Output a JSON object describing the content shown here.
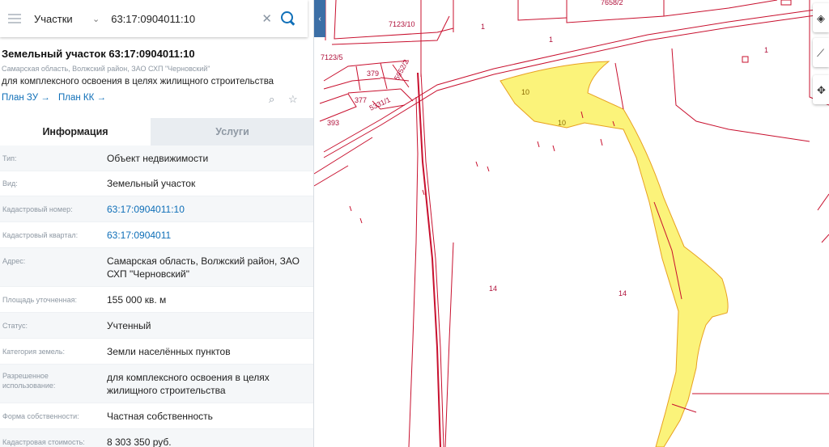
{
  "search": {
    "type_label": "Участки",
    "query": "63:17:0904011:10"
  },
  "parcel": {
    "title": "Земельный участок 63:17:0904011:10",
    "address": "Самарская область, Волжский район, ЗАО СХП \"Черновский\"",
    "purpose": "для комплексного освоения в целях жилищного строительства",
    "links": {
      "plan_zu": "План ЗУ →",
      "plan_kk": "План КК →"
    }
  },
  "tabs": [
    {
      "label": "Информация",
      "active": true
    },
    {
      "label": "Услуги",
      "active": false
    }
  ],
  "rows": [
    {
      "label": "Тип:",
      "value": "Объект недвижимости"
    },
    {
      "label": "Вид:",
      "value": "Земельный участок"
    },
    {
      "label": "Кадастровый номер:",
      "value": "63:17:0904011:10",
      "link": true
    },
    {
      "label": "Кадастровый квартал:",
      "value": "63:17:0904011",
      "link": true
    },
    {
      "label": "Адрес:",
      "value": "Самарская область, Волжский район, ЗАО СХП \"Черновский\""
    },
    {
      "label": "Площадь уточненная:",
      "value": "155 000 кв. м"
    },
    {
      "label": "Статус:",
      "value": "Учтенный"
    },
    {
      "label": "Категория земель:",
      "value": "Земли населённых пунктов"
    },
    {
      "label": "Разрешенное использование:",
      "value": "для комплексного освоения в целях жилищного строительства"
    },
    {
      "label": "Форма собственности:",
      "value": "Частная собственность"
    },
    {
      "label": "Кадастровая стоимость:",
      "value": "8 303 350 руб."
    }
  ],
  "map": {
    "labels": [
      "7123/10",
      "7658/2",
      "7123/5",
      "379",
      "5952/2",
      "377",
      "5331/1",
      "393",
      "1",
      "10",
      "14"
    ],
    "colors": {
      "boundary": "#c8102e",
      "parcel_fill": "#fbf37a",
      "parcel_stroke": "#e8a020",
      "label": "#b0103a"
    }
  },
  "colors": {
    "accent": "#0f6fb8",
    "muted": "#8e98a3",
    "tab_inactive_bg": "#e9edf1"
  },
  "icons": [
    "menu-icon",
    "chevron-down-icon",
    "close-icon",
    "search-icon",
    "chevron-left-icon",
    "zoom-to-icon",
    "star-icon",
    "layers-icon",
    "ruler-icon",
    "compass-icon"
  ]
}
